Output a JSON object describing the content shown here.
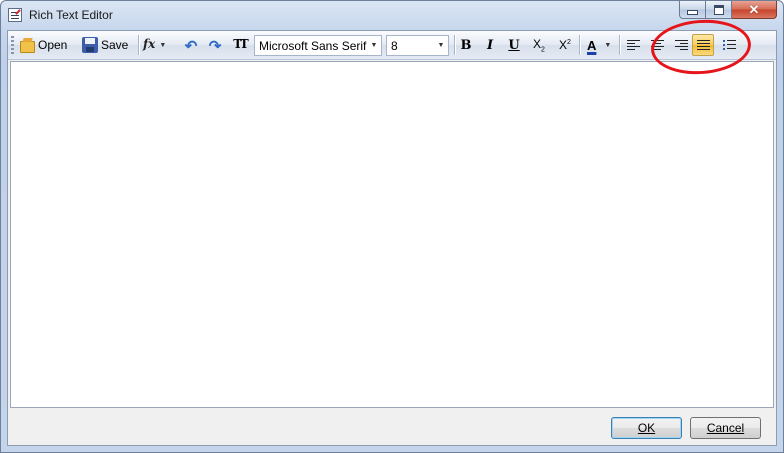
{
  "window": {
    "title": "Rich Text Editor",
    "icon": "document-edit-icon"
  },
  "caption": {
    "minimize": "minimize-icon",
    "maximize": "maximize-icon",
    "close_glyph": "✕"
  },
  "toolbar": {
    "open_label": "Open",
    "save_label": "Save",
    "fx_glyph": "fx",
    "undo_glyph": "↶",
    "redo_glyph": "↷",
    "clear_format_glyph": "TT",
    "font_family": "Microsoft Sans Serif",
    "font_size": "8",
    "bold_glyph": "B",
    "italic_glyph": "I",
    "underline_glyph": "U",
    "subscript_glyph": "X",
    "superscript_glyph": "X",
    "font_color_glyph": "A",
    "dropdown_glyph": "▼",
    "icons": [
      "open-folder-icon",
      "save-disk-icon",
      "fx-icon",
      "undo-icon",
      "redo-icon",
      "clear-format-icon",
      "bold-icon",
      "italic-icon",
      "underline-icon",
      "subscript-icon",
      "superscript-icon",
      "font-color-icon",
      "align-left-icon",
      "align-center-icon",
      "align-right-icon",
      "align-justify-icon",
      "bullet-list-icon"
    ],
    "active_alignment": "justify"
  },
  "editor": {
    "content": ""
  },
  "footer": {
    "ok_label": "OK",
    "cancel_label": "Cancel"
  },
  "colors": {
    "annotation": "#e6141b",
    "active_button": "#f8cd5c"
  }
}
